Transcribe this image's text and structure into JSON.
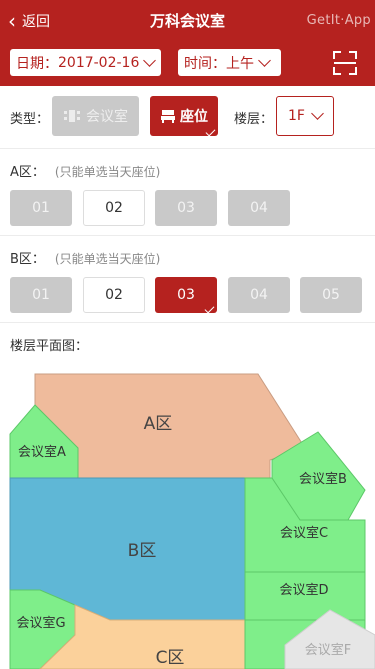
{
  "header": {
    "back_label": "返回",
    "title": "万科会议室",
    "watermark": "GetIt·App"
  },
  "filters": {
    "date_label": "日期：",
    "date_value": "2017-02-16",
    "time_label": "时间：",
    "time_value": "上午",
    "scan_icon": "scan-icon"
  },
  "type_row": {
    "label": "类型：",
    "options": [
      {
        "label": "会议室",
        "icon": "conference-icon",
        "selected": false
      },
      {
        "label": "座位",
        "icon": "seat-icon",
        "selected": true
      }
    ],
    "floor_label": "楼层：",
    "floor_value": "1F"
  },
  "zones": [
    {
      "name": "A区：",
      "hint": "(只能单选当天座位)",
      "seats": [
        {
          "label": "01",
          "state": "unavailable"
        },
        {
          "label": "02",
          "state": "available"
        },
        {
          "label": "03",
          "state": "unavailable"
        },
        {
          "label": "04",
          "state": "unavailable"
        }
      ]
    },
    {
      "name": "B区：",
      "hint": "(只能单选当天座位)",
      "seats": [
        {
          "label": "01",
          "state": "unavailable"
        },
        {
          "label": "02",
          "state": "available"
        },
        {
          "label": "03",
          "state": "selected"
        },
        {
          "label": "04",
          "state": "unavailable"
        },
        {
          "label": "05",
          "state": "unavailable"
        }
      ]
    }
  ],
  "floor_plan": {
    "title": "楼层平面图：",
    "areas": {
      "a_zone": "A区",
      "b_zone": "B区",
      "c_zone": "C区",
      "room_a": "会议室A",
      "room_b": "会议室B",
      "room_c": "会议室C",
      "room_d": "会议室D",
      "room_f": "会议室F",
      "room_g": "会议室G"
    },
    "colors": {
      "a_zone": "#efbb9c",
      "b_zone": "#5fb7d6",
      "c_zone": "#fbd19b",
      "room": "#7fee8a",
      "room_f": "#e6e6e6"
    }
  },
  "colors": {
    "brand": "#b5221f",
    "disabled": "#c9c9c9"
  }
}
